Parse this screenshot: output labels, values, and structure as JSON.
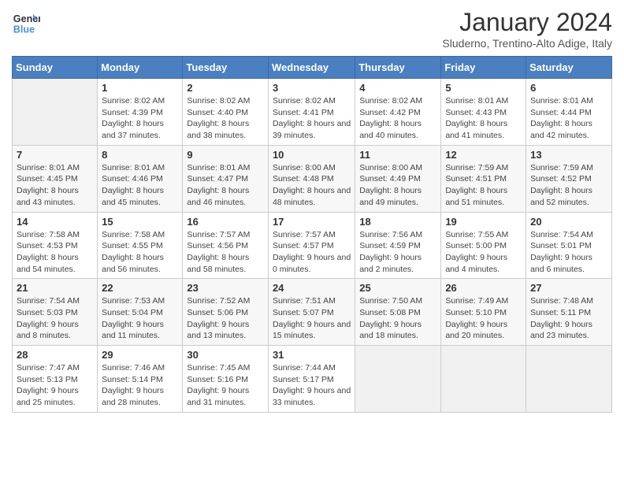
{
  "header": {
    "logo_line1": "General",
    "logo_line2": "Blue",
    "month": "January 2024",
    "location": "Sluderno, Trentino-Alto Adige, Italy"
  },
  "days_of_week": [
    "Sunday",
    "Monday",
    "Tuesday",
    "Wednesday",
    "Thursday",
    "Friday",
    "Saturday"
  ],
  "weeks": [
    [
      {
        "num": "",
        "sunrise": "",
        "sunset": "",
        "daylight": ""
      },
      {
        "num": "1",
        "sunrise": "Sunrise: 8:02 AM",
        "sunset": "Sunset: 4:39 PM",
        "daylight": "Daylight: 8 hours and 37 minutes."
      },
      {
        "num": "2",
        "sunrise": "Sunrise: 8:02 AM",
        "sunset": "Sunset: 4:40 PM",
        "daylight": "Daylight: 8 hours and 38 minutes."
      },
      {
        "num": "3",
        "sunrise": "Sunrise: 8:02 AM",
        "sunset": "Sunset: 4:41 PM",
        "daylight": "Daylight: 8 hours and 39 minutes."
      },
      {
        "num": "4",
        "sunrise": "Sunrise: 8:02 AM",
        "sunset": "Sunset: 4:42 PM",
        "daylight": "Daylight: 8 hours and 40 minutes."
      },
      {
        "num": "5",
        "sunrise": "Sunrise: 8:01 AM",
        "sunset": "Sunset: 4:43 PM",
        "daylight": "Daylight: 8 hours and 41 minutes."
      },
      {
        "num": "6",
        "sunrise": "Sunrise: 8:01 AM",
        "sunset": "Sunset: 4:44 PM",
        "daylight": "Daylight: 8 hours and 42 minutes."
      }
    ],
    [
      {
        "num": "7",
        "sunrise": "Sunrise: 8:01 AM",
        "sunset": "Sunset: 4:45 PM",
        "daylight": "Daylight: 8 hours and 43 minutes."
      },
      {
        "num": "8",
        "sunrise": "Sunrise: 8:01 AM",
        "sunset": "Sunset: 4:46 PM",
        "daylight": "Daylight: 8 hours and 45 minutes."
      },
      {
        "num": "9",
        "sunrise": "Sunrise: 8:01 AM",
        "sunset": "Sunset: 4:47 PM",
        "daylight": "Daylight: 8 hours and 46 minutes."
      },
      {
        "num": "10",
        "sunrise": "Sunrise: 8:00 AM",
        "sunset": "Sunset: 4:48 PM",
        "daylight": "Daylight: 8 hours and 48 minutes."
      },
      {
        "num": "11",
        "sunrise": "Sunrise: 8:00 AM",
        "sunset": "Sunset: 4:49 PM",
        "daylight": "Daylight: 8 hours and 49 minutes."
      },
      {
        "num": "12",
        "sunrise": "Sunrise: 7:59 AM",
        "sunset": "Sunset: 4:51 PM",
        "daylight": "Daylight: 8 hours and 51 minutes."
      },
      {
        "num": "13",
        "sunrise": "Sunrise: 7:59 AM",
        "sunset": "Sunset: 4:52 PM",
        "daylight": "Daylight: 8 hours and 52 minutes."
      }
    ],
    [
      {
        "num": "14",
        "sunrise": "Sunrise: 7:58 AM",
        "sunset": "Sunset: 4:53 PM",
        "daylight": "Daylight: 8 hours and 54 minutes."
      },
      {
        "num": "15",
        "sunrise": "Sunrise: 7:58 AM",
        "sunset": "Sunset: 4:55 PM",
        "daylight": "Daylight: 8 hours and 56 minutes."
      },
      {
        "num": "16",
        "sunrise": "Sunrise: 7:57 AM",
        "sunset": "Sunset: 4:56 PM",
        "daylight": "Daylight: 8 hours and 58 minutes."
      },
      {
        "num": "17",
        "sunrise": "Sunrise: 7:57 AM",
        "sunset": "Sunset: 4:57 PM",
        "daylight": "Daylight: 9 hours and 0 minutes."
      },
      {
        "num": "18",
        "sunrise": "Sunrise: 7:56 AM",
        "sunset": "Sunset: 4:59 PM",
        "daylight": "Daylight: 9 hours and 2 minutes."
      },
      {
        "num": "19",
        "sunrise": "Sunrise: 7:55 AM",
        "sunset": "Sunset: 5:00 PM",
        "daylight": "Daylight: 9 hours and 4 minutes."
      },
      {
        "num": "20",
        "sunrise": "Sunrise: 7:54 AM",
        "sunset": "Sunset: 5:01 PM",
        "daylight": "Daylight: 9 hours and 6 minutes."
      }
    ],
    [
      {
        "num": "21",
        "sunrise": "Sunrise: 7:54 AM",
        "sunset": "Sunset: 5:03 PM",
        "daylight": "Daylight: 9 hours and 8 minutes."
      },
      {
        "num": "22",
        "sunrise": "Sunrise: 7:53 AM",
        "sunset": "Sunset: 5:04 PM",
        "daylight": "Daylight: 9 hours and 11 minutes."
      },
      {
        "num": "23",
        "sunrise": "Sunrise: 7:52 AM",
        "sunset": "Sunset: 5:06 PM",
        "daylight": "Daylight: 9 hours and 13 minutes."
      },
      {
        "num": "24",
        "sunrise": "Sunrise: 7:51 AM",
        "sunset": "Sunset: 5:07 PM",
        "daylight": "Daylight: 9 hours and 15 minutes."
      },
      {
        "num": "25",
        "sunrise": "Sunrise: 7:50 AM",
        "sunset": "Sunset: 5:08 PM",
        "daylight": "Daylight: 9 hours and 18 minutes."
      },
      {
        "num": "26",
        "sunrise": "Sunrise: 7:49 AM",
        "sunset": "Sunset: 5:10 PM",
        "daylight": "Daylight: 9 hours and 20 minutes."
      },
      {
        "num": "27",
        "sunrise": "Sunrise: 7:48 AM",
        "sunset": "Sunset: 5:11 PM",
        "daylight": "Daylight: 9 hours and 23 minutes."
      }
    ],
    [
      {
        "num": "28",
        "sunrise": "Sunrise: 7:47 AM",
        "sunset": "Sunset: 5:13 PM",
        "daylight": "Daylight: 9 hours and 25 minutes."
      },
      {
        "num": "29",
        "sunrise": "Sunrise: 7:46 AM",
        "sunset": "Sunset: 5:14 PM",
        "daylight": "Daylight: 9 hours and 28 minutes."
      },
      {
        "num": "30",
        "sunrise": "Sunrise: 7:45 AM",
        "sunset": "Sunset: 5:16 PM",
        "daylight": "Daylight: 9 hours and 31 minutes."
      },
      {
        "num": "31",
        "sunrise": "Sunrise: 7:44 AM",
        "sunset": "Sunset: 5:17 PM",
        "daylight": "Daylight: 9 hours and 33 minutes."
      },
      {
        "num": "",
        "sunrise": "",
        "sunset": "",
        "daylight": ""
      },
      {
        "num": "",
        "sunrise": "",
        "sunset": "",
        "daylight": ""
      },
      {
        "num": "",
        "sunrise": "",
        "sunset": "",
        "daylight": ""
      }
    ]
  ]
}
